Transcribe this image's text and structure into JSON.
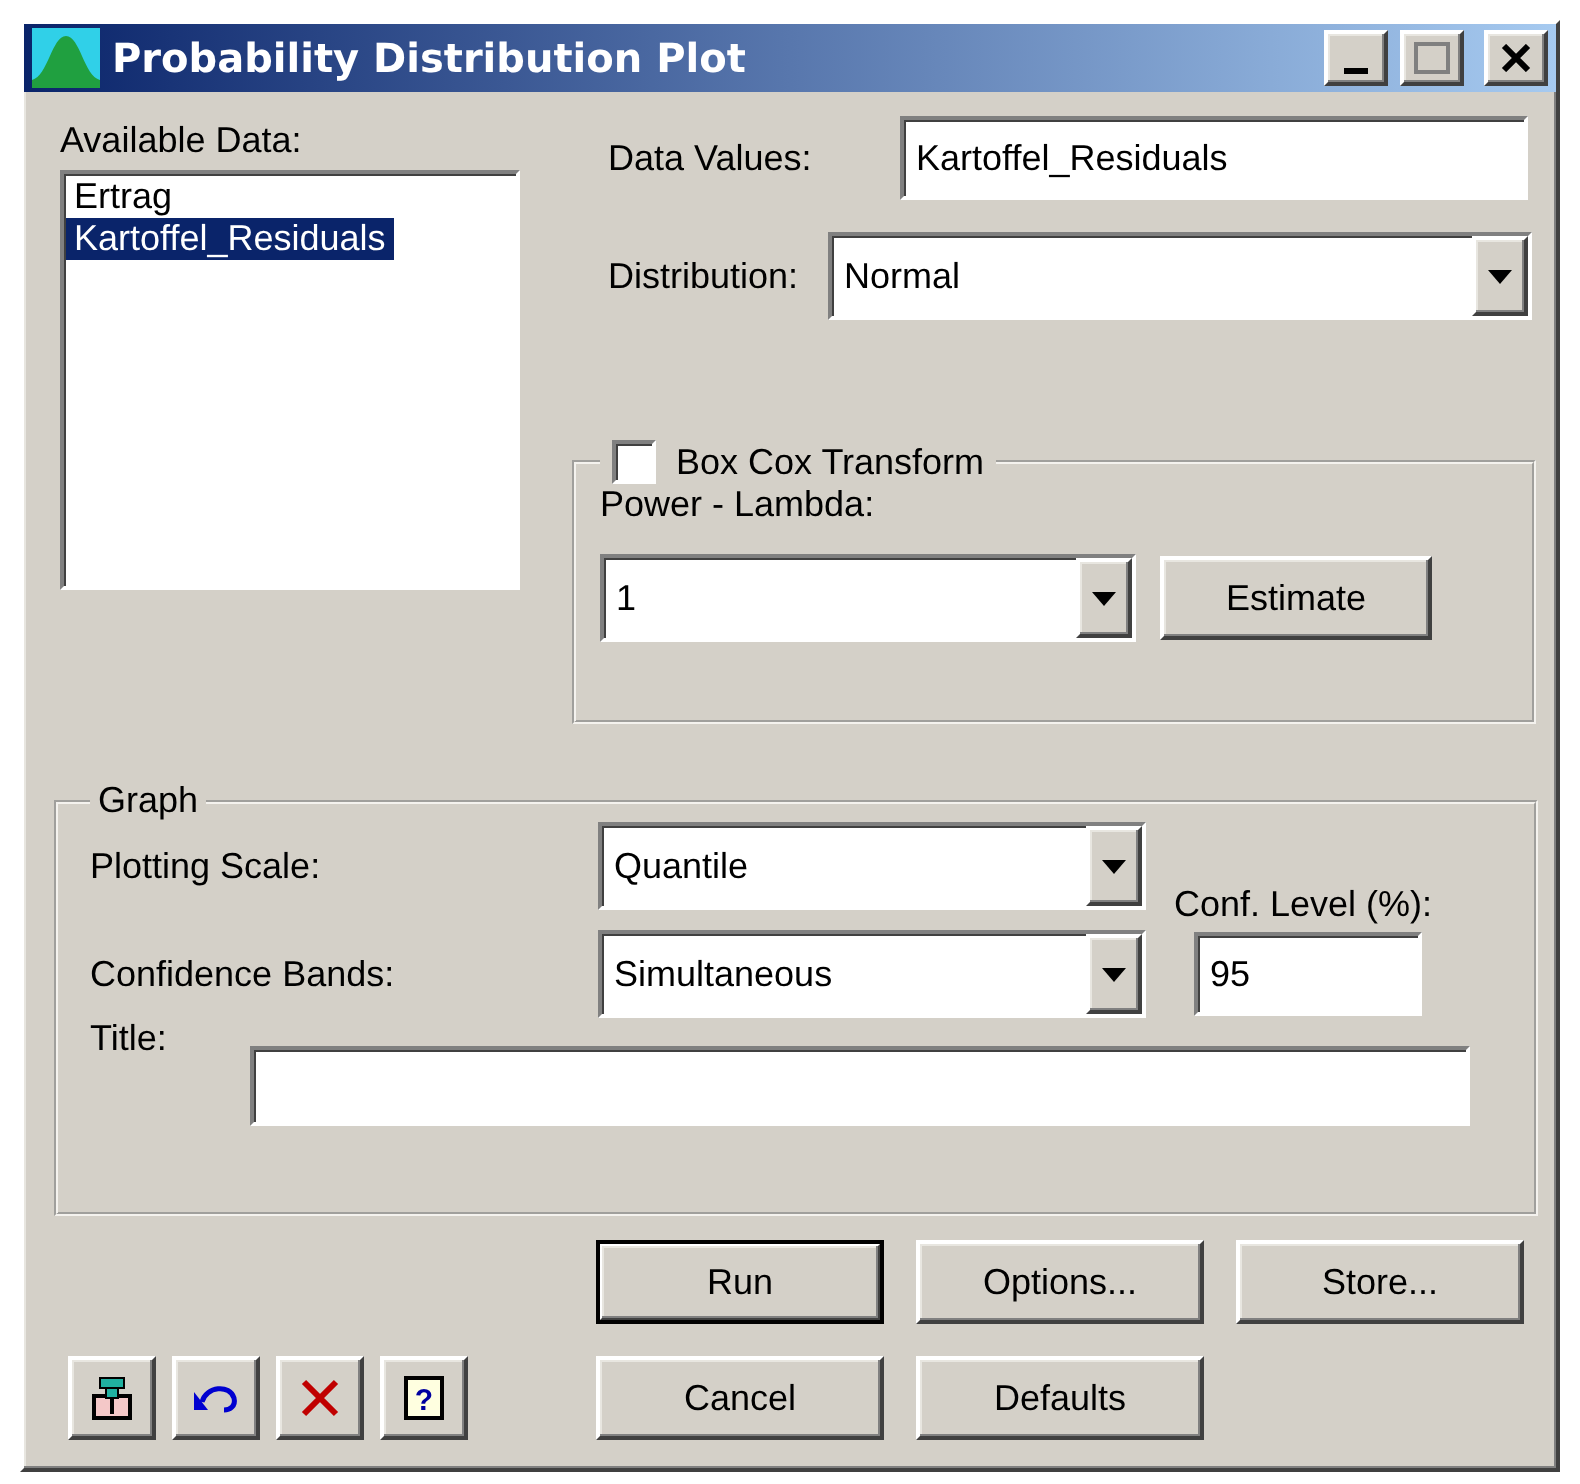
{
  "window": {
    "title": "Probability Distribution Plot"
  },
  "available_data": {
    "label": "Available Data:",
    "items": [
      {
        "label": "Ertrag",
        "selected": false
      },
      {
        "label": "Kartoffel_Residuals",
        "selected": true
      }
    ]
  },
  "data_values": {
    "label": "Data Values:",
    "value": "Kartoffel_Residuals"
  },
  "distribution": {
    "label": "Distribution:",
    "value": "Normal"
  },
  "box_cox": {
    "label": "Box Cox Transform",
    "checked": false,
    "lambda_label": "Power - Lambda:",
    "lambda_value": "1",
    "estimate_button": "Estimate"
  },
  "graph": {
    "title": "Graph",
    "plotting_scale": {
      "label": "Plotting Scale:",
      "value": "Quantile"
    },
    "confidence_bands": {
      "label": "Confidence Bands:",
      "value": "Simultaneous"
    },
    "conf_level": {
      "label": "Conf. Level (%):",
      "value": "95"
    },
    "title_field": {
      "label": "Title:"
    }
  },
  "buttons": [
    {
      "label": "Run",
      "default": true
    },
    {
      "label": "Options...",
      "default": false
    },
    {
      "label": "Store...",
      "default": false
    },
    {
      "label": "Cancel",
      "default": false
    },
    {
      "label": "Defaults",
      "default": false
    }
  ],
  "toolbar": [
    {
      "kind": "pin"
    },
    {
      "kind": "undo"
    },
    {
      "kind": "delete"
    },
    {
      "kind": "help",
      "glyph": "?"
    }
  ]
}
